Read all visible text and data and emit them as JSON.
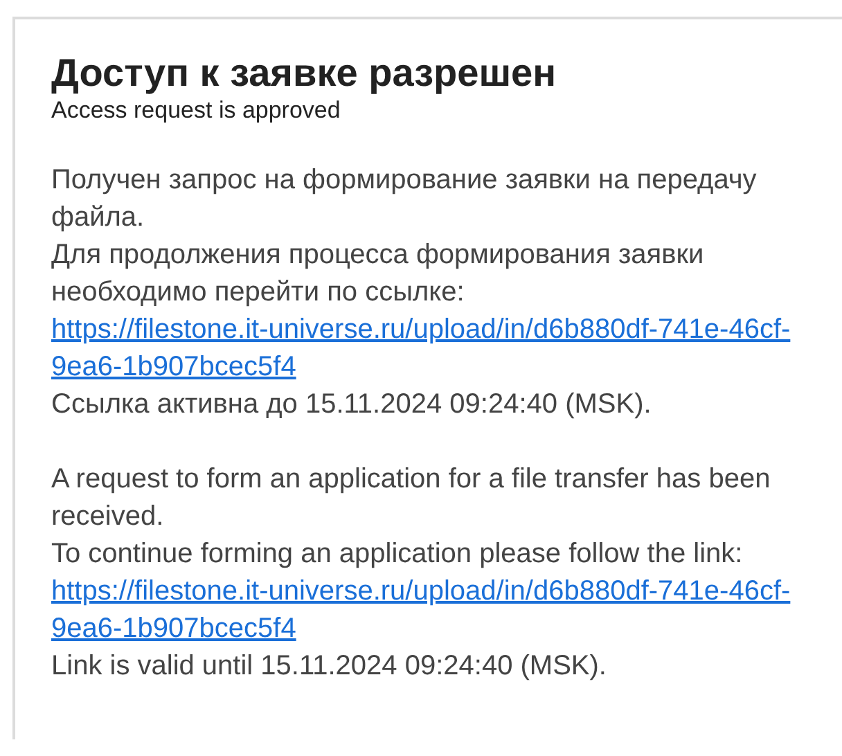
{
  "title": "Доступ к заявке разрешен",
  "subtitle": "Access request is approved",
  "sections": [
    {
      "intro": "Получен запрос на формирование заявки на передачу файла.",
      "prompt": "Для продолжения процесса формирования заявки необходимо перейти по ссылке:",
      "link": "https://filestone.it-universe.ru/upload/in/d6b880df-741e-46cf-9ea6-1b907bcec5f4",
      "validity": "Ссылка активна до 15.11.2024 09:24:40 (MSK)."
    },
    {
      "intro": "A request to form an application for a file transfer has been received.",
      "prompt": "To continue forming an application please follow the link:",
      "link": "https://filestone.it-universe.ru/upload/in/d6b880df-741e-46cf-9ea6-1b907bcec5f4",
      "validity": "Link is valid until 15.11.2024 09:24:40 (MSK)."
    }
  ]
}
